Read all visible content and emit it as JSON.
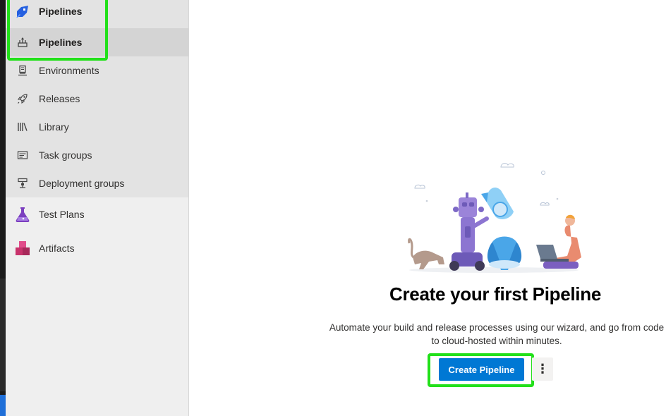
{
  "sidebar": {
    "section": {
      "label": "Pipelines",
      "icon": "pipelines-logo-icon"
    },
    "items": [
      {
        "label": "Pipelines",
        "icon": "pipelines-sub-icon",
        "selected": true
      },
      {
        "label": "Environments",
        "icon": "environments-icon"
      },
      {
        "label": "Releases",
        "icon": "rocket-icon"
      },
      {
        "label": "Library",
        "icon": "library-icon"
      },
      {
        "label": "Task groups",
        "icon": "task-groups-icon"
      },
      {
        "label": "Deployment groups",
        "icon": "deployment-groups-icon"
      }
    ],
    "other_sections": [
      {
        "label": "Test Plans",
        "icon": "test-plans-flask-icon"
      },
      {
        "label": "Artifacts",
        "icon": "artifacts-icon"
      }
    ]
  },
  "empty_state": {
    "title": "Create your first Pipeline",
    "description": "Automate your build and release processes using our wizard, and go from code to cloud-hosted within minutes.",
    "primary_button": "Create Pipeline",
    "more_button": "⋮"
  },
  "colors": {
    "accent": "#0078d4",
    "highlight": "#22e01a",
    "sidebar_bg": "#efefef",
    "test_plans": "#7b3fbf",
    "artifacts": "#c8326b"
  }
}
